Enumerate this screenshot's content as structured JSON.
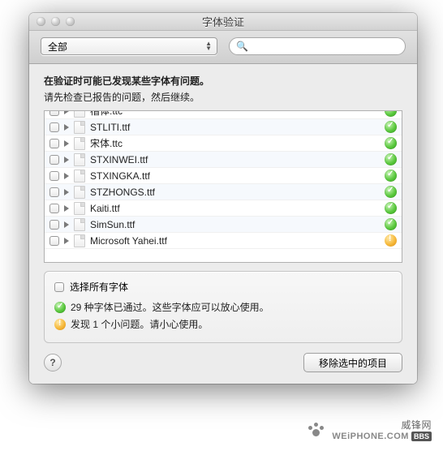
{
  "window": {
    "title": "字体验证"
  },
  "toolbar": {
    "filter_selected": "全部",
    "search_placeholder": ""
  },
  "message": {
    "line1": "在验证时可能已发现某些字体有问题。",
    "line2": "请先检查已报告的问题，然后继续。"
  },
  "fonts": [
    {
      "name": "楷体.ttc",
      "status": "ok",
      "partial": true
    },
    {
      "name": "STLITI.ttf",
      "status": "ok"
    },
    {
      "name": "宋体.ttc",
      "status": "ok"
    },
    {
      "name": "STXINWEI.ttf",
      "status": "ok"
    },
    {
      "name": "STXINGKA.ttf",
      "status": "ok"
    },
    {
      "name": "STZHONGS.ttf",
      "status": "ok"
    },
    {
      "name": "Kaiti.ttf",
      "status": "ok"
    },
    {
      "name": "SimSun.ttf",
      "status": "ok"
    },
    {
      "name": "Microsoft Yahei.ttf",
      "status": "warn"
    }
  ],
  "infobox": {
    "select_all": "选择所有字体",
    "passed": "29 种字体已通过。这些字体应可以放心使用。",
    "warning": "发现 1 个小问题。请小心使用。"
  },
  "footer": {
    "help": "?",
    "remove_button": "移除选中的项目"
  },
  "watermark": {
    "text": "威锋网",
    "site": "WEiPHONE.COM",
    "badge": "BBS"
  }
}
